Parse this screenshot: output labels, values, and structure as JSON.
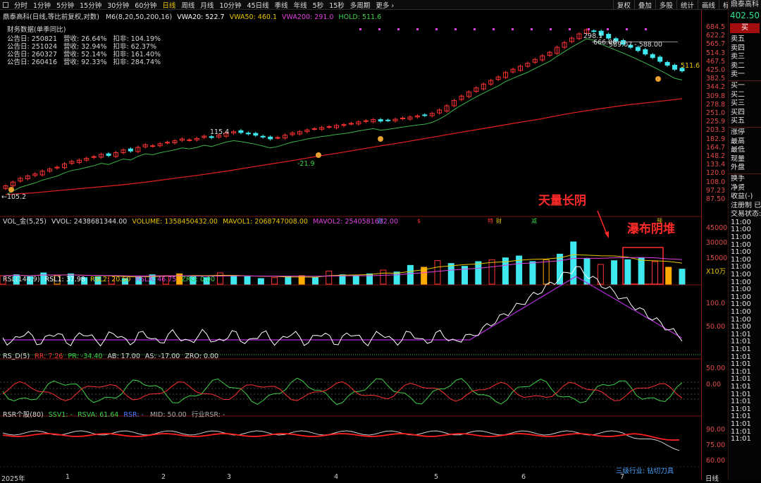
{
  "toolbar": {
    "tabs": [
      "分时",
      "1分钟",
      "5分钟",
      "15分钟",
      "30分钟",
      "60分钟",
      "日线",
      "周线",
      "月线",
      "10分钟",
      "45日线",
      "季线",
      "年线",
      "5秒",
      "15秒",
      "多周期",
      "更多 ›"
    ],
    "active_tab": "日线",
    "right": [
      "复权",
      "叠加",
      "多股",
      "统计",
      "画线",
      "标记",
      "返回"
    ]
  },
  "stock": {
    "name": "鼎泰高科",
    "price": "402.50",
    "buy_label": "买"
  },
  "main_header": {
    "title": "鼎泰高科(日线,等比前复权,对数)",
    "indicator": "M6(8,20,50,200,16)",
    "vwa20": "VWA20: 522.7",
    "vwa50": "VWA50: 460.1",
    "vwa200": "VWA200: 291.0",
    "hold": "HOLD: 511.6"
  },
  "financials": {
    "title": "财务数据(单季同比)",
    "rows": [
      "公告日: 250821   营收: 26.64%   扣非: 104.19%",
      "公告日: 251024   营收: 32.94%   扣非: 62.37%",
      "公告日: 260327   营收: 52.14%   扣非: 161.40%",
      "公告日: 260416   营收: 92.33%   扣非: 284.74%"
    ]
  },
  "price_labels": {
    "low": "←105.2",
    "p115": "115.4",
    "m21": "-21.9",
    "p298": "298.1",
    "p666": "666.00",
    "range": "589.07 - 588.00",
    "hold_val": "511.6"
  },
  "price_axis": [
    "684.5",
    "622.2",
    "565.7",
    "514.3",
    "467.5",
    "425.0",
    "382.5",
    "344.2",
    "309.8",
    "278.8",
    "251.0",
    "225.9",
    "203.3",
    "182.9",
    "164.7",
    "148.2",
    "133.4",
    "120.0",
    "108.0",
    "97.23",
    "87.50"
  ],
  "event_marks": [
    "财",
    "$",
    "特",
    "财",
    "减",
    "预"
  ],
  "annotations": {
    "big_volume": "天量长阴",
    "waterfall": "瀑布阴堆"
  },
  "volume_header": {
    "name": "VOL_金(5,25)",
    "vvol": "VVOL: 2438681344.00",
    "volume": "VOLUME: 1358450432.00",
    "mavol1": "MAVOL1: 2068747008.00",
    "mavol2": "MAVOL2: 2540581632.00"
  },
  "volume_axis": [
    "45000",
    "30000",
    "15000",
    "X10万"
  ],
  "rsl_header": {
    "name": "RSL(144,9)",
    "rsl1": "RSL1: 37.98",
    "rsl2": "RSL2: 20.50",
    "rsla": "RSLA: 46.75",
    "zro": "ZRO: 0.00"
  },
  "rsl_axis": [
    "100.0",
    "50.00"
  ],
  "rsd_header": {
    "name": "RS_D(5)",
    "rr": "RR: 7.26",
    "pr": "PR: -34.40",
    "ab": "AB: 17.00",
    "as": "AS: -17.00",
    "zro": "ZRO: 0.00"
  },
  "rsd_axis": [
    "50.00",
    "0.00"
  ],
  "rsr_header": {
    "name": "RSR个股(80)",
    "ssv1": "SSV1: -",
    "rsva": "RSVA: 61.64",
    "rsr": "RSR: -",
    "mid": "MID: 50.00",
    "ind": "行业RSR: -"
  },
  "rsr_axis": [
    "90.00",
    "75.00",
    "60.00"
  ],
  "industry": "三级行业: 钻切刀具",
  "x_axis": {
    "months": [
      "2025年",
      "1",
      "2",
      "3",
      "4",
      "5",
      "6",
      "7"
    ],
    "period": "日线"
  },
  "side_panel": {
    "asks": [
      "卖五",
      "卖四",
      "卖三",
      "卖二",
      "卖一"
    ],
    "bids": [
      "买一",
      "买二",
      "买三",
      "买四",
      "买五"
    ],
    "stats": [
      "涨停",
      "最高",
      "最低",
      "现量",
      "外盘"
    ],
    "more": [
      "换手",
      "净资",
      "收益(-)"
    ],
    "reg": "注册制 已",
    "trade_state": "交易状态:",
    "times": [
      "11:00",
      "11:00",
      "11:00",
      "11:00",
      "11:00",
      "11:00",
      "11:00",
      "11:00",
      "11:00",
      "11:00",
      "11:00",
      "11:00",
      "11:00",
      "11:00",
      "11:00",
      "11:01",
      "11:01",
      "11:01",
      "11:01",
      "11:01",
      "11:01",
      "11:01",
      "11:01",
      "11:01",
      "11:01",
      "11:01",
      "11:01",
      "11:01",
      "11:01",
      "11:01"
    ]
  },
  "colors": {
    "up": "#ff3232",
    "down": "#3fe8ee",
    "ma": "#39b54a",
    "ma200": "#d61e1e",
    "accent": "#e8c400"
  },
  "chart_data": [
    {
      "type": "line",
      "title": "鼎泰高科(日线,等比前复权,对数)",
      "series": [
        {
          "name": "price_close",
          "values": [
            105.2,
            110,
            115,
            118,
            121,
            125,
            128,
            131,
            136,
            140,
            142,
            145,
            148,
            152,
            150,
            155,
            160,
            158,
            165,
            170,
            168,
            172,
            175,
            178,
            182,
            180,
            183,
            188,
            185,
            190,
            195,
            198,
            196,
            193,
            190,
            186,
            182,
            185,
            190,
            195,
            198,
            202,
            205,
            208,
            210,
            213,
            215,
            218,
            222,
            225,
            228,
            224,
            226,
            229,
            232,
            235,
            238,
            240,
            245,
            255,
            268,
            285,
            300,
            315,
            330,
            345,
            360,
            375,
            395,
            410,
            425,
            440,
            460,
            480,
            500,
            530,
            560,
            590,
            620,
            650,
            640,
            610,
            590,
            570,
            550,
            530,
            510,
            490,
            470,
            450,
            430,
            410,
            402.5
          ]
        },
        {
          "name": "VWA200",
          "values": [
            95,
            97,
            100,
            103,
            106,
            110,
            115,
            120,
            126,
            133,
            140,
            148,
            156,
            165,
            174,
            184,
            195,
            206,
            218,
            230,
            245,
            258,
            270,
            280,
            291
          ]
        }
      ],
      "ylim": [
        87.5,
        684.5
      ]
    },
    {
      "type": "bar",
      "title": "VOL_金(5,25)",
      "values": [
        0.9,
        1.0,
        0.8,
        1.2,
        0.9,
        1.1,
        0.7,
        0.8,
        0.9,
        0.6,
        0.8,
        1.0,
        0.9,
        1.1,
        0.8,
        0.7,
        1.2,
        0.9,
        0.8,
        0.6,
        0.7,
        0.8,
        0.9,
        0.7,
        1.4,
        1.0,
        0.9,
        1.1,
        1.5,
        1.3,
        2.0,
        1.8,
        2.5,
        2.2,
        1.9,
        2.4,
        2.6,
        2.8,
        3.0,
        2.4,
        2.6,
        3.2,
        4.5,
        2.7,
        2.1,
        2.5,
        2.6,
        2.8,
        2.4,
        1.8,
        1.6
      ],
      "ylim": [
        0,
        45000
      ]
    }
  ]
}
